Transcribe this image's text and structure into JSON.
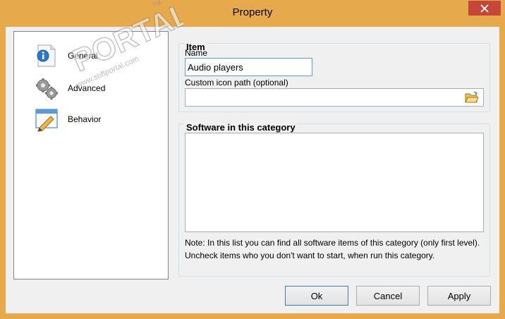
{
  "window": {
    "title": "Property",
    "accent": "#e6a94b",
    "close_color": "#c7463a"
  },
  "nav": {
    "items": [
      {
        "label": "General",
        "icon": "info-document-icon"
      },
      {
        "label": "Advanced",
        "icon": "gears-icon"
      },
      {
        "label": "Behavior",
        "icon": "pencil-window-icon"
      }
    ]
  },
  "item_group": {
    "title": "Item",
    "name_label": "Name",
    "name_value": "Audio players",
    "icon_path_label": "Custom icon path (optional)",
    "icon_path_value": ""
  },
  "software_group": {
    "title": "Software in this category",
    "note": "Note: In this list you can find all software items of this category (only first level). Uncheck items who you don't want to start, when run this category."
  },
  "buttons": {
    "ok": "Ok",
    "cancel": "Cancel",
    "apply": "Apply"
  },
  "watermark": {
    "logo_text": "PORTAL",
    "tm": "TM",
    "url": "www.softportal.com"
  }
}
